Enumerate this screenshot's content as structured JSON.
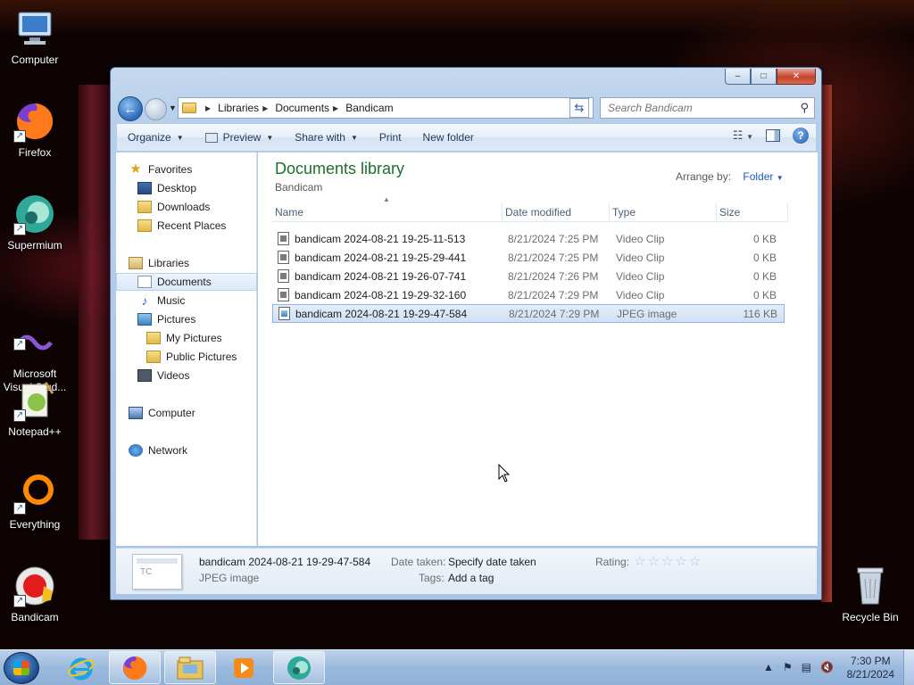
{
  "desktop": {
    "icons": [
      {
        "label": "Computer",
        "icon": "computer-icon"
      },
      {
        "label": "Firefox",
        "icon": "firefox-icon"
      },
      {
        "label": "Supermium",
        "icon": "supermium-icon"
      },
      {
        "label": "Microsoft\nVisual Stud...",
        "icon": "visual-studio-icon"
      },
      {
        "label": "Notepad++",
        "icon": "notepadpp-icon"
      },
      {
        "label": "Everything",
        "icon": "everything-icon"
      },
      {
        "label": "Bandicam",
        "icon": "bandicam-icon"
      },
      {
        "label": "Recycle Bin",
        "icon": "recycle-bin-icon"
      }
    ]
  },
  "window": {
    "caption": {
      "minimize": "–",
      "maximize": "□",
      "close": "✕"
    },
    "address": {
      "crumbs": [
        "Libraries",
        "Documents",
        "Bandicam"
      ]
    },
    "search": {
      "placeholder": "Search Bandicam"
    },
    "toolbar": {
      "organize": "Organize",
      "preview": "Preview",
      "share_with": "Share with",
      "print": "Print",
      "new_folder": "New folder",
      "help": "?"
    },
    "nav": {
      "favorites": "Favorites",
      "desktop": "Desktop",
      "downloads": "Downloads",
      "recent_places": "Recent Places",
      "libraries": "Libraries",
      "documents": "Documents",
      "music": "Music",
      "pictures": "Pictures",
      "my_pictures": "My Pictures",
      "public_pictures": "Public Pictures",
      "videos": "Videos",
      "computer": "Computer",
      "network": "Network"
    },
    "content": {
      "title": "Documents library",
      "subtitle": "Bandicam",
      "arrange_label": "Arrange by:",
      "arrange_value": "Folder",
      "columns": {
        "name": "Name",
        "date": "Date modified",
        "type": "Type",
        "size": "Size"
      },
      "files": [
        {
          "name": "bandicam 2024-08-21 19-25-11-513",
          "date": "8/21/2024 7:25 PM",
          "type": "Video Clip",
          "size": "0 KB"
        },
        {
          "name": "bandicam 2024-08-21 19-25-29-441",
          "date": "8/21/2024 7:25 PM",
          "type": "Video Clip",
          "size": "0 KB"
        },
        {
          "name": "bandicam 2024-08-21 19-26-07-741",
          "date": "8/21/2024 7:26 PM",
          "type": "Video Clip",
          "size": "0 KB"
        },
        {
          "name": "bandicam 2024-08-21 19-29-32-160",
          "date": "8/21/2024 7:29 PM",
          "type": "Video Clip",
          "size": "0 KB"
        },
        {
          "name": "bandicam 2024-08-21 19-29-47-584",
          "date": "8/21/2024 7:29 PM",
          "type": "JPEG image",
          "size": "116 KB"
        }
      ],
      "selected_index": 4
    },
    "details": {
      "name": "bandicam 2024-08-21 19-29-47-584",
      "type": "JPEG image",
      "date_taken_label": "Date taken:",
      "date_taken_value": "Specify date taken",
      "tags_label": "Tags:",
      "tags_value": "Add a tag",
      "rating_label": "Rating:",
      "rating_stars": "☆☆☆☆☆",
      "rating_value": 0
    }
  },
  "taskbar": {
    "time": "7:30 PM",
    "date": "8/21/2024"
  },
  "colors": {
    "library_title": "#1e6e2e",
    "link_blue": "#1e5bb8",
    "selection_bg": "#cfdff5",
    "close_red": "#c6432c"
  }
}
